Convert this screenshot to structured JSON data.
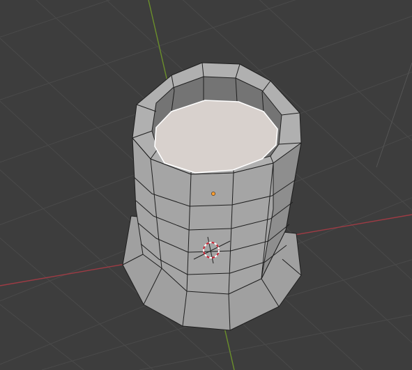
{
  "viewport": {
    "name": "3D Viewport",
    "background": "#3d3d3d",
    "grid_color": "#4a4a4a",
    "axis_x_color": "#9e3b44",
    "axis_y_color": "#6b8f2b"
  },
  "mesh": {
    "object": "cylinder-cup",
    "mode": "edit",
    "outer_wall_color": "#a5a5a5",
    "outer_wall_shade_color": "#8e8e8e",
    "inner_wall_color": "#747474",
    "rim_color": "#b0b0b0",
    "selected_face_color": "#d8d1cd",
    "selected_edge_color": "#ffffff",
    "wire_color": "#1e1e1e"
  },
  "overlays": {
    "origin_dot_color": "#ffa033",
    "cursor_3d": "3d-cursor-icon",
    "cursor_colors": [
      "#ffffff",
      "#cc2233"
    ]
  }
}
